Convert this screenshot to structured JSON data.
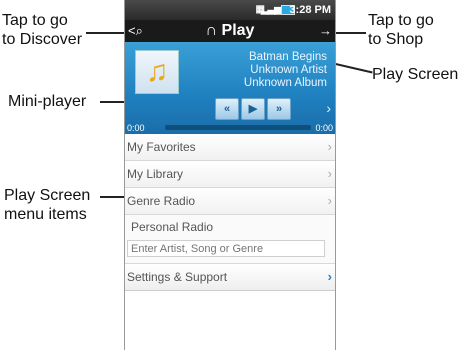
{
  "callouts": {
    "discover": "Tap to go\nto Discover",
    "shop": "Tap to go\nto Shop",
    "play_screen": "Play Screen",
    "mini_player": "Mini-player",
    "menu_items": "Play Screen\nmenu items"
  },
  "status": {
    "time": "3:28 PM"
  },
  "header": {
    "title": "∩ Play",
    "back": "<⌕",
    "shop": "→"
  },
  "player": {
    "track": "Batman Begins",
    "artist": "Unknown Artist",
    "album": "Unknown Album",
    "elapsed": "0:00",
    "total": "0:00",
    "progress": 0,
    "buttons": {
      "rewind": "«",
      "play": "▶",
      "forward": "»"
    }
  },
  "menu": {
    "favorites": "My Favorites",
    "library": "My Library",
    "genre_radio": "Genre Radio",
    "personal_radio": "Personal Radio",
    "search_placeholder": "Enter Artist, Song or Genre",
    "settings": "Settings & Support"
  }
}
